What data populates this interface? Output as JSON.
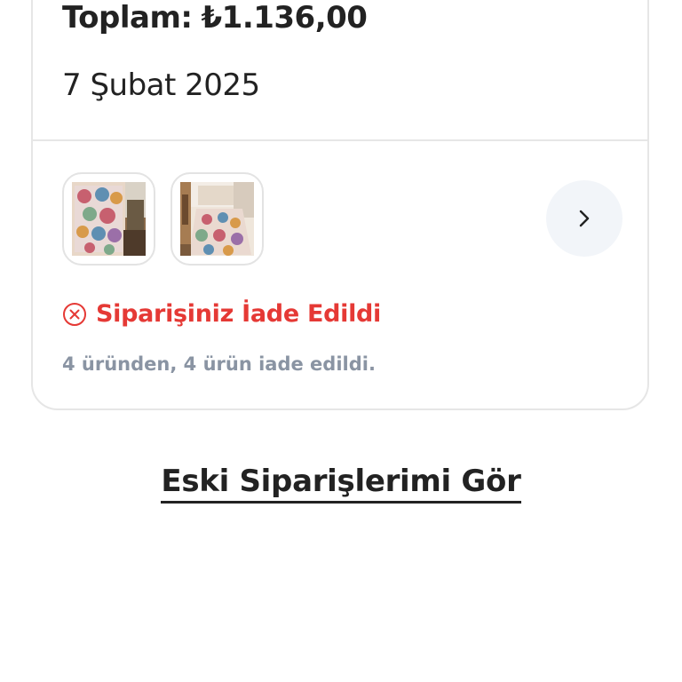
{
  "order": {
    "total_label": "Toplam:",
    "total_value": "₺1.136,00",
    "date": "7 Şubat 2025",
    "product_images": [
      "rug-runner-product-image",
      "rug-hallway-product-image"
    ],
    "status": {
      "icon": "x-circle-icon",
      "text": "Siparişiniz İade Edildi",
      "color": "#e53935",
      "detail": "4 üründen, 4 ürün iade edildi."
    },
    "next_icon": "chevron-right-icon"
  },
  "footer": {
    "old_orders_label": "Eski Siparişlerimi Gör"
  }
}
